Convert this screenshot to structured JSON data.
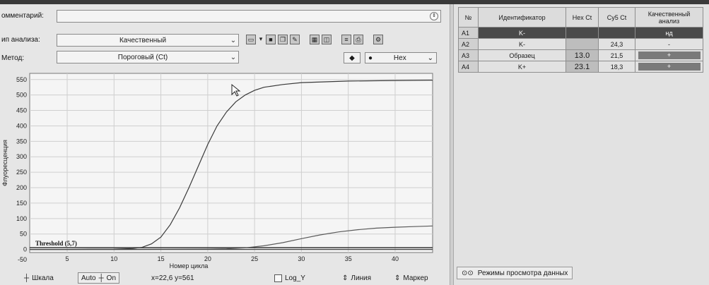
{
  "form": {
    "comment_label": "омментарий:",
    "analysis_type_label": "ип анализа:",
    "analysis_type_value": "Качественный",
    "method_label": "Метод:",
    "method_value": "Пороговый (Ct)",
    "channel_value": "Hex"
  },
  "icons": [
    "open-folder-icon",
    "dropdown-arrow-icon",
    "save-icon",
    "copy-icon",
    "edit-icon",
    "grid-icon",
    "layout-icon",
    "sort-icon",
    "print-icon",
    "settings-icon"
  ],
  "chart_data": {
    "type": "line",
    "title": "",
    "xlabel": "Номер цикла",
    "ylabel": "Флуоресценция",
    "xlim": [
      1,
      44
    ],
    "ylim": [
      -10,
      570
    ],
    "x_ticks": [
      5,
      10,
      15,
      20,
      25,
      30,
      35,
      40
    ],
    "y_ticks": [
      -50,
      0,
      50,
      100,
      150,
      200,
      250,
      300,
      350,
      400,
      450,
      500,
      550
    ],
    "y_tick_labels": [
      "-50",
      "0",
      "50",
      "100",
      "150",
      "200",
      "250",
      "300",
      "350",
      "400",
      "450",
      "500",
      "550"
    ],
    "grid": true,
    "threshold": {
      "label": "Threshold (5,7)",
      "value": 5.7
    },
    "series": [
      {
        "x": [
          1,
          5,
          10,
          12,
          13,
          14,
          15,
          16,
          17,
          18,
          19,
          20,
          21,
          22,
          23,
          24,
          25,
          26,
          28,
          30,
          35,
          40,
          44
        ],
        "y": [
          0,
          0,
          1,
          3,
          7,
          18,
          40,
          80,
          135,
          200,
          270,
          340,
          400,
          445,
          478,
          500,
          515,
          525,
          534,
          540,
          545,
          547,
          548
        ]
      },
      {
        "x": [
          1,
          10,
          20,
          22,
          24,
          26,
          28,
          30,
          32,
          34,
          36,
          38,
          40,
          42,
          44
        ],
        "y": [
          0,
          0,
          1,
          2,
          5,
          12,
          22,
          35,
          47,
          57,
          64,
          69,
          72,
          74,
          76
        ]
      },
      {
        "x": [
          1,
          44
        ],
        "y": [
          0,
          0
        ]
      }
    ]
  },
  "bottom": {
    "scale_label": "Шкала",
    "auto_label": "Auto",
    "on_label": "On",
    "coords": "x=22,6 y=561",
    "log_label": "Log_Y",
    "line_label": "Линия",
    "marker_label": "Маркер",
    "view_modes_label": "Режимы просмотра данных"
  },
  "table": {
    "headers": [
      "№",
      "Идентификатор",
      "Hex Ct",
      "Cy5 Ct",
      "Качественный анализ"
    ],
    "rows": [
      {
        "no": "A1",
        "id": "K-",
        "hex": "",
        "cy5": "",
        "qual": "нд"
      },
      {
        "no": "A2",
        "id": "K-",
        "hex": "",
        "cy5": "24,3",
        "qual": "-"
      },
      {
        "no": "A3",
        "id": "Образец",
        "hex": "13.0",
        "cy5": "21,5",
        "qual": "+"
      },
      {
        "no": "A4",
        "id": "K+",
        "hex": "23.1",
        "cy5": "18,3",
        "qual": "+"
      }
    ]
  }
}
